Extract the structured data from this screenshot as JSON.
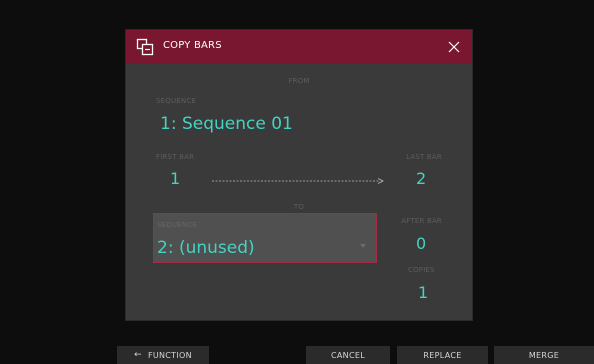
{
  "dialog": {
    "title": "COPY BARS",
    "from_label": "FROM",
    "from_sequence": {
      "label": "SEQUENCE",
      "value": "1: Sequence 01"
    },
    "first_bar": {
      "label": "FIRST BAR",
      "value": "1"
    },
    "last_bar": {
      "label": "LAST BAR",
      "value": "2"
    },
    "to_label": "TO",
    "to_sequence": {
      "label": "SEQUENCE",
      "value": "2: (unused)"
    },
    "after_bar": {
      "label": "AFTER BAR",
      "value": "0"
    },
    "copies": {
      "label": "COPIES",
      "value": "1"
    }
  },
  "bottom_bar": {
    "function_label": "FUNCTION",
    "cancel_label": "CANCEL",
    "replace_label": "REPLACE",
    "merge_label": "MERGE"
  },
  "colors": {
    "titlebar": "#7a1730",
    "accent_value": "#44d3c2",
    "focus_border": "#a02e45"
  },
  "icons": {
    "title": "copy-bars-icon",
    "close": "close-icon",
    "arrow": "right-arrow-icon",
    "function": "left-arrow-icon"
  }
}
